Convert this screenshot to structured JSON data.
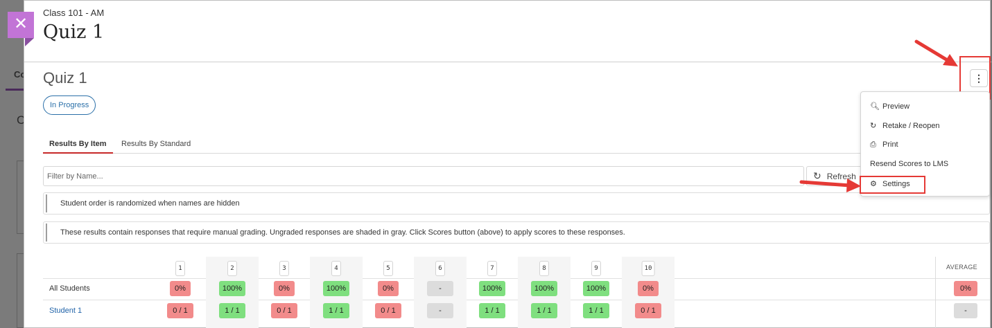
{
  "background": {
    "c_top": "C",
    "tab_label": "Co",
    "c_mid": "C"
  },
  "header": {
    "class_name": "Class 101 - AM",
    "title": "Quiz 1"
  },
  "quiz": {
    "title": "Quiz 1",
    "status": "In Progress"
  },
  "tabs": [
    {
      "label": "Results By Item",
      "active": true
    },
    {
      "label": "Results By Standard",
      "active": false
    }
  ],
  "filter": {
    "placeholder": "Filter by Name...",
    "value": ""
  },
  "refresh_label": "Refresh",
  "notices": [
    "Student order is randomized when names are hidden",
    "These results contain responses that require manual grading. Ungraded responses are shaded in gray. Click Scores button (above) to apply scores to these responses."
  ],
  "results": {
    "columns": [
      "1",
      "2",
      "3",
      "4",
      "5",
      "6",
      "7",
      "8",
      "9",
      "10"
    ],
    "average_header": "AVERAGE",
    "rows": [
      {
        "label": "All Students",
        "cells": [
          "0%",
          "100%",
          "0%",
          "100%",
          "0%",
          "-",
          "100%",
          "100%",
          "100%",
          "0%"
        ],
        "status": [
          "red",
          "green",
          "red",
          "green",
          "red",
          "gray",
          "green",
          "green",
          "green",
          "red"
        ],
        "average": "0%",
        "average_status": "red"
      },
      {
        "label": "Student 1",
        "cells": [
          "0 / 1",
          "1 / 1",
          "0 / 1",
          "1 / 1",
          "0 / 1",
          "-",
          "1 / 1",
          "1 / 1",
          "1 / 1",
          "0 / 1"
        ],
        "status": [
          "red",
          "green",
          "red",
          "green",
          "red",
          "gray",
          "green",
          "green",
          "green",
          "red"
        ],
        "average": "-",
        "average_status": "gray"
      }
    ]
  },
  "menu": {
    "items": [
      {
        "label": "Preview",
        "icon": "search-icon"
      },
      {
        "label": "Retake / Reopen",
        "icon": "refresh-icon"
      },
      {
        "label": "Print",
        "icon": "printer-icon"
      },
      {
        "label": "Resend Scores to LMS",
        "icon": ""
      },
      {
        "label": "Settings",
        "icon": "gear-icon"
      }
    ]
  },
  "colors": {
    "accent_purple": "#c274d6",
    "link_blue": "#1f62a8",
    "tab_underline": "#c62828",
    "highlight_red": "#e53935",
    "score_red": "#f28b8b",
    "score_green": "#7fdf7f",
    "score_gray": "#dcdcdc"
  }
}
